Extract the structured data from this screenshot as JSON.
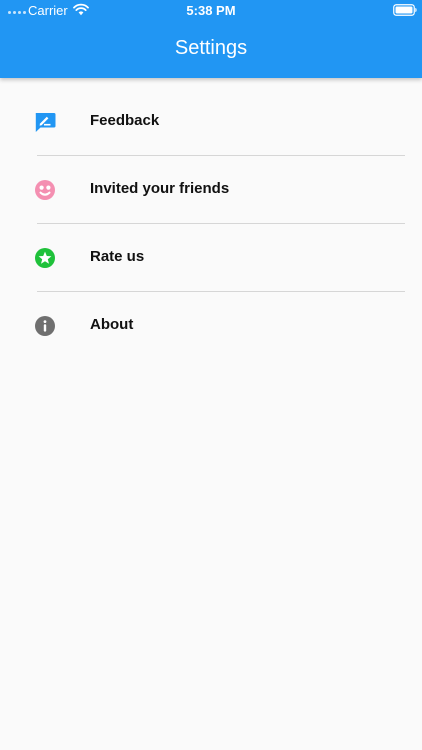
{
  "status_bar": {
    "carrier": "Carrier",
    "time": "5:38 PM"
  },
  "app_bar": {
    "title": "Settings",
    "background_color": "#2196f3"
  },
  "settings_items": [
    {
      "label": "Feedback",
      "icon": "feedback-icon",
      "icon_color": "#2196f3"
    },
    {
      "label": "Invited your friends",
      "icon": "friends-icon",
      "icon_color": "#f48fb1"
    },
    {
      "label": "Rate us",
      "icon": "star-icon",
      "icon_color": "#1fc13a"
    },
    {
      "label": "About",
      "icon": "info-icon",
      "icon_color": "#6f6f6f"
    }
  ]
}
